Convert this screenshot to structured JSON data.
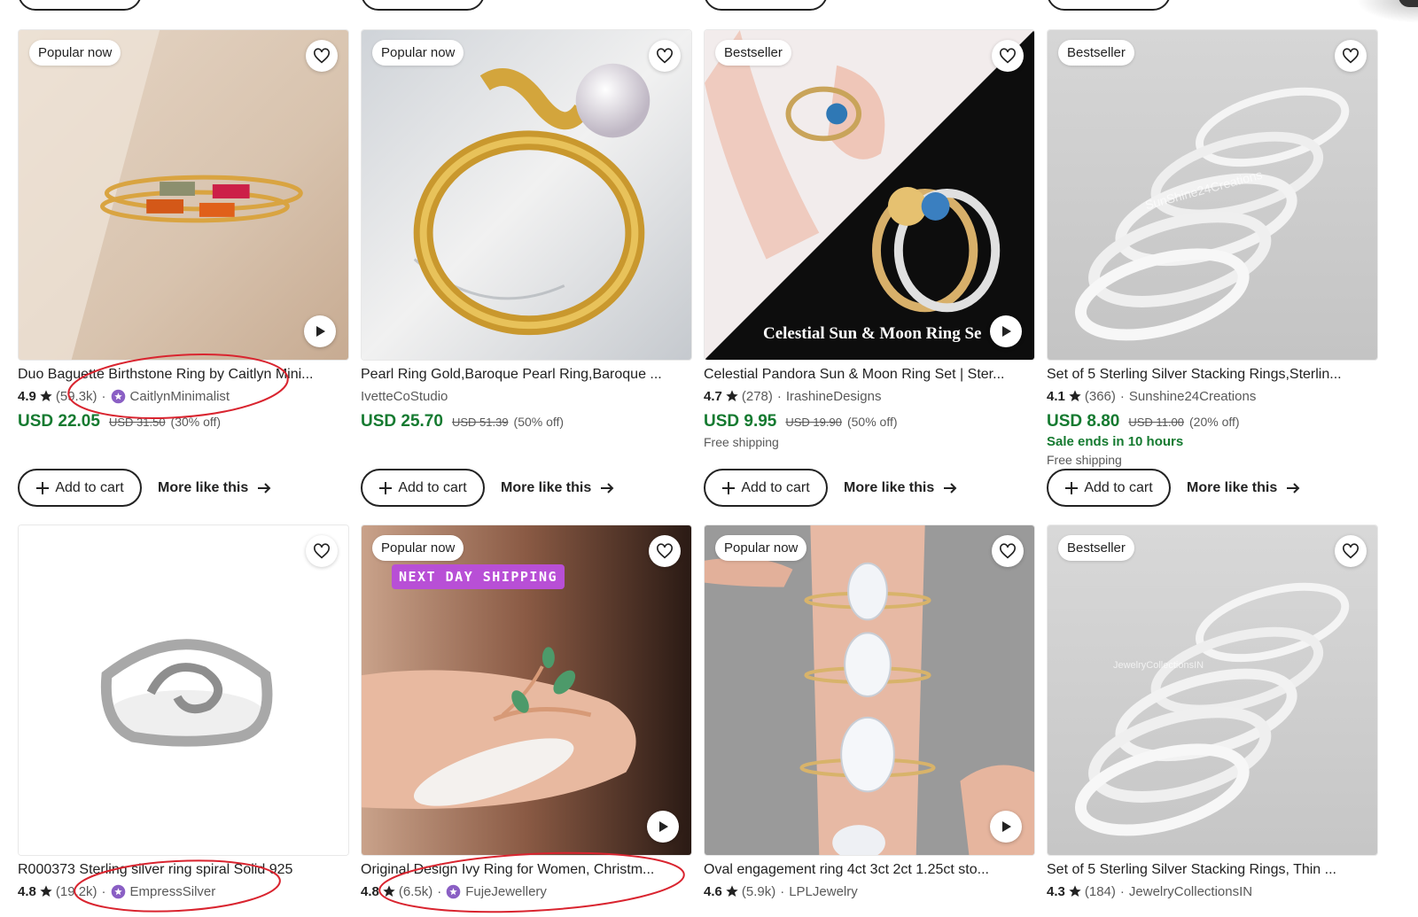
{
  "colors": {
    "price": "#157a30",
    "sale": "#157a30",
    "annotation": "#d9242f",
    "shipping_badge": "#b84fd6"
  },
  "row1": [
    {
      "badge": "Popular now",
      "has_video": true,
      "title": "Duo Baguette Birthstone Ring by Caitlyn Mini...",
      "rating": "4.9",
      "reviews": "(59.3k)",
      "star_seller": true,
      "shop": "CaitlynMinimalist",
      "price": "USD 22.05",
      "original_price": "USD 31.50",
      "discount": "(30% off)",
      "cart_label": "Add to cart",
      "more_label": "More like this"
    },
    {
      "badge": "Popular now",
      "has_video": false,
      "title": "Pearl Ring Gold,Baroque Pearl Ring,Baroque ...",
      "shop": "IvetteCoStudio",
      "price": "USD 25.70",
      "original_price": "USD 51.39",
      "discount": "(50% off)",
      "cart_label": "Add to cart",
      "more_label": "More like this"
    },
    {
      "badge": "Bestseller",
      "has_video": true,
      "image_text": "Celestial Sun & Moon Ring Se",
      "title": "Celestial Pandora Sun & Moon Ring Set | Ster...",
      "rating": "4.7",
      "reviews": "(278)",
      "shop": "IrashineDesigns",
      "price": "USD 9.95",
      "original_price": "USD 19.90",
      "discount": "(50% off)",
      "shipping": "Free shipping",
      "cart_label": "Add to cart",
      "more_label": "More like this"
    },
    {
      "badge": "Bestseller",
      "has_video": false,
      "watermark": "SunShine24Creations",
      "title": "Set of 5 Sterling Silver Stacking Rings,Sterlin...",
      "rating": "4.1",
      "reviews": "(366)",
      "shop": "Sunshine24Creations",
      "price": "USD 8.80",
      "original_price": "USD 11.00",
      "discount": "(20% off)",
      "sale": "Sale ends in 10 hours",
      "shipping": "Free shipping",
      "cart_label": "Add to cart",
      "more_label": "More like this"
    }
  ],
  "row2": [
    {
      "title": "R000373 Sterling silver ring spiral Solid 925",
      "rating": "4.8",
      "reviews": "(19.2k)",
      "star_seller": true,
      "shop": "EmpressSilver"
    },
    {
      "badge": "Popular now",
      "shipping_tag": "NEXT DAY SHIPPING",
      "has_video": true,
      "title": "Original Design Ivy Ring for Women, Christm...",
      "rating": "4.8",
      "reviews": "(6.5k)",
      "star_seller": true,
      "shop": "FujeJewellery"
    },
    {
      "badge": "Popular now",
      "has_video": true,
      "title": "Oval engagement ring 4ct 3ct 2ct 1.25ct sto...",
      "rating": "4.6",
      "reviews": "(5.9k)",
      "shop": "LPLJewelry"
    },
    {
      "badge": "Bestseller",
      "watermark": "JewelryCollectionsIN",
      "title": "Set of 5 Sterling Silver Stacking Rings, Thin ...",
      "rating": "4.3",
      "reviews": "(184)",
      "shop": "JewelryCollectionsIN"
    }
  ]
}
